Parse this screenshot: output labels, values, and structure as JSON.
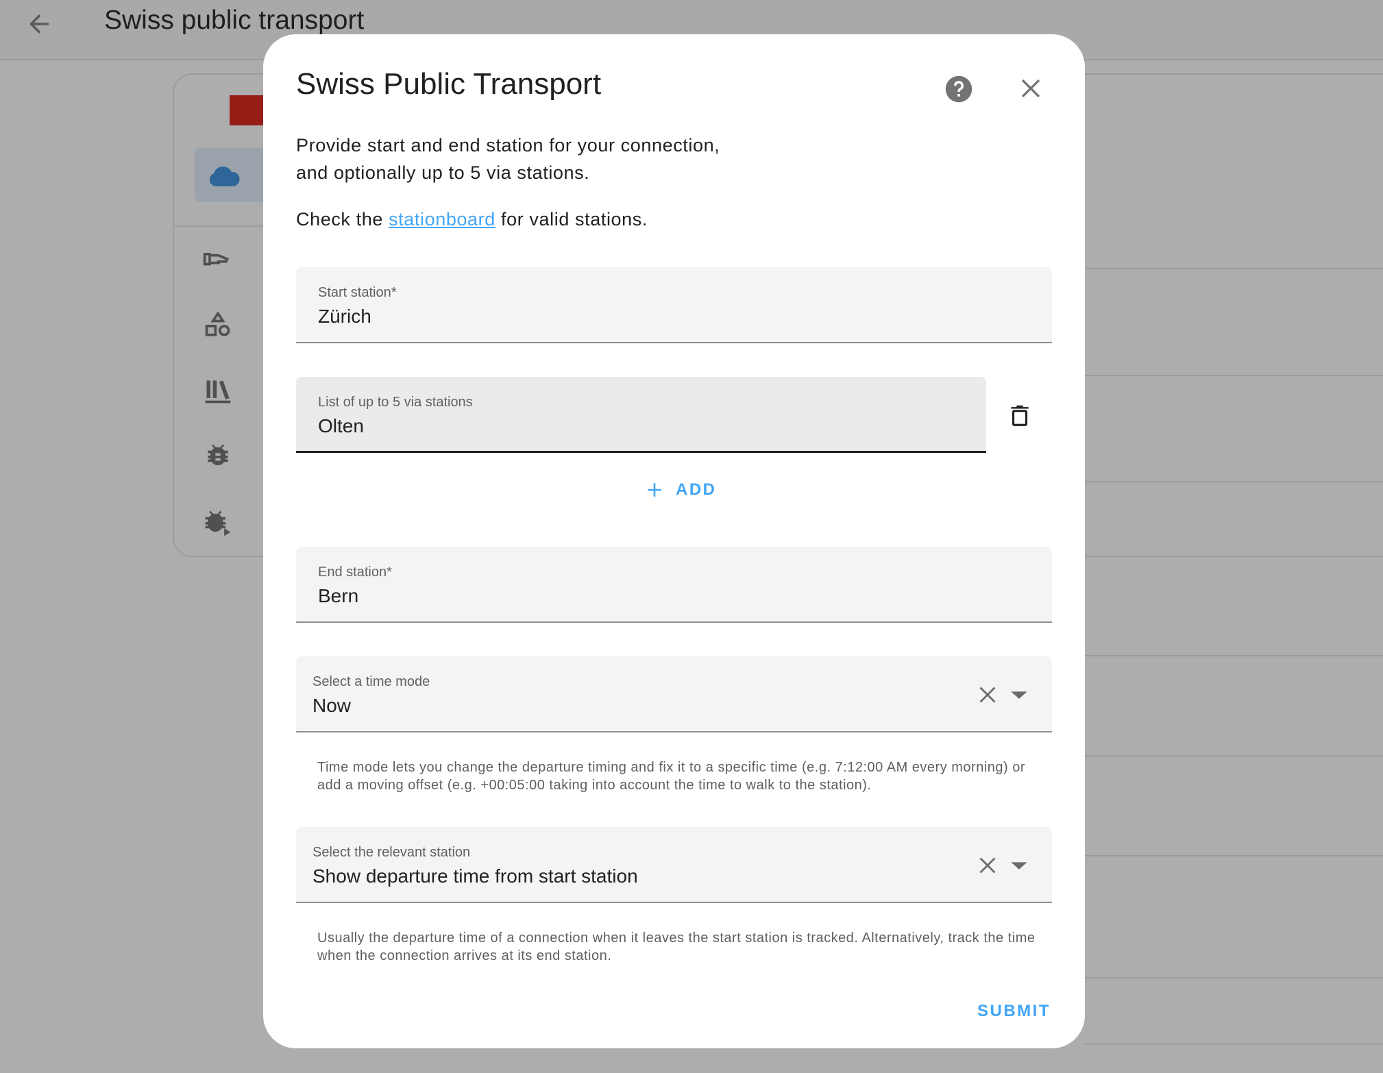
{
  "page": {
    "title": "Swiss public transport"
  },
  "dialog": {
    "title": "Swiss Public Transport",
    "description_line1": "Provide start and end station for your connection,",
    "description_line2": "and optionally up to 5 via stations.",
    "check_prefix": "Check the",
    "check_link": "stationboard",
    "check_suffix": "for valid stations.",
    "start_station": {
      "label": "Start station*",
      "value": "Zürich"
    },
    "via_stations": {
      "label": "List of up to 5 via stations",
      "value": "Olten"
    },
    "add_label": "ADD",
    "end_station": {
      "label": "End station*",
      "value": "Bern"
    },
    "time_mode": {
      "label": "Select a time mode",
      "value": "Now",
      "helper": "Time mode lets you change the departure timing and fix it to a specific time (e.g. 7:12:00 AM every morning) or add a moving offset (e.g. +00:05:00 taking into account the time to walk to the station)."
    },
    "relevant_station": {
      "label": "Select the relevant station",
      "value": "Show departure time from start station",
      "helper": "Usually the departure time of a connection when it leaves the start station is tracked. Alternatively, track the time when the connection arrives at its end station."
    },
    "submit_label": "SUBMIT"
  },
  "colors": {
    "accent": "#42a5f5",
    "overlay": "#adadad",
    "brand_red": "#951f17",
    "cloud": "#2f6699"
  }
}
